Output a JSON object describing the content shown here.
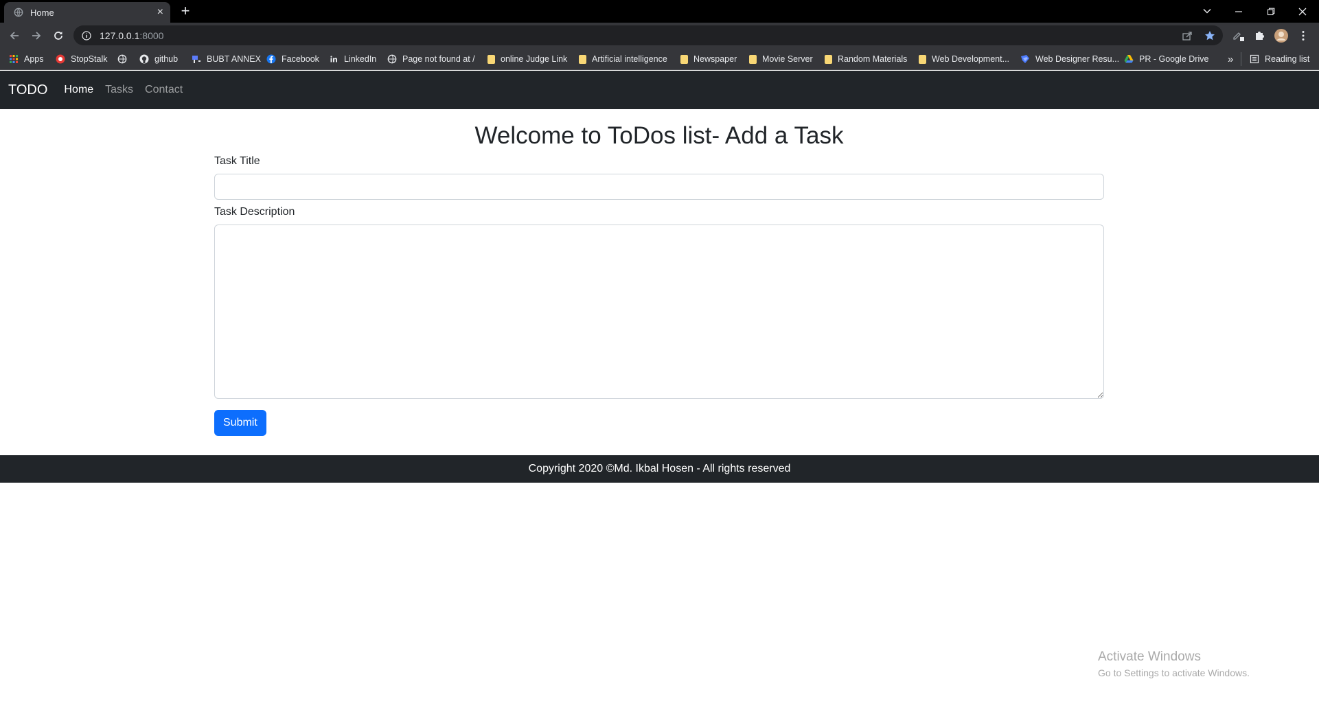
{
  "browser": {
    "tab": {
      "title": "Home",
      "close_glyph": "×",
      "favicon": "globe-icon"
    },
    "new_tab_glyph": "+",
    "address": {
      "host": "127.0.0.1",
      "port": ":8000"
    },
    "bookmarks": [
      {
        "label": "Apps",
        "icon": "apps-grid-icon"
      },
      {
        "label": "StopStalk",
        "icon": "stopstalk-icon"
      },
      {
        "label": "",
        "icon": "globe-icon"
      },
      {
        "label": "github",
        "icon": "github-icon"
      },
      {
        "label": "BUBT ANNEX",
        "icon": "bubt-icon"
      },
      {
        "label": "Facebook",
        "icon": "facebook-icon"
      },
      {
        "label": "LinkedIn",
        "icon": "linkedin-icon"
      },
      {
        "label": "Page not found at /",
        "icon": "globe-icon"
      },
      {
        "label": "online Judge Link",
        "icon": "folder-icon"
      },
      {
        "label": "Artificial intelligence",
        "icon": "folder-icon"
      },
      {
        "label": "Newspaper",
        "icon": "folder-icon"
      },
      {
        "label": "Movie Server",
        "icon": "folder-icon"
      },
      {
        "label": "Random Materials",
        "icon": "folder-icon"
      },
      {
        "label": "Web Development...",
        "icon": "folder-icon"
      },
      {
        "label": "Web Designer Resu...",
        "icon": "web-designer-icon"
      },
      {
        "label": "PR - Google Drive",
        "icon": "google-drive-icon"
      }
    ],
    "overflow_glyph": "»",
    "reading_list": "Reading list"
  },
  "navbar": {
    "brand": "TODO",
    "links": [
      {
        "label": "Home",
        "active": true
      },
      {
        "label": "Tasks",
        "active": false
      },
      {
        "label": "Contact",
        "active": false
      }
    ]
  },
  "form": {
    "heading": "Welcome to ToDos list- Add a Task",
    "title_label": "Task Title",
    "title_value": "",
    "description_label": "Task Description",
    "description_value": "",
    "submit_label": "Submit"
  },
  "footer": {
    "text": "Copyright 2020 ©Md. Ikbal Hosen - All rights reserved"
  },
  "watermark": {
    "line1": "Activate Windows",
    "line2": "Go to Settings to activate Windows."
  },
  "colors": {
    "navbar_bg": "#212529",
    "primary": "#0d6efd",
    "chrome_bg": "#35363a",
    "tabstrip_bg": "#000000",
    "omnibox_bg": "#202124"
  }
}
